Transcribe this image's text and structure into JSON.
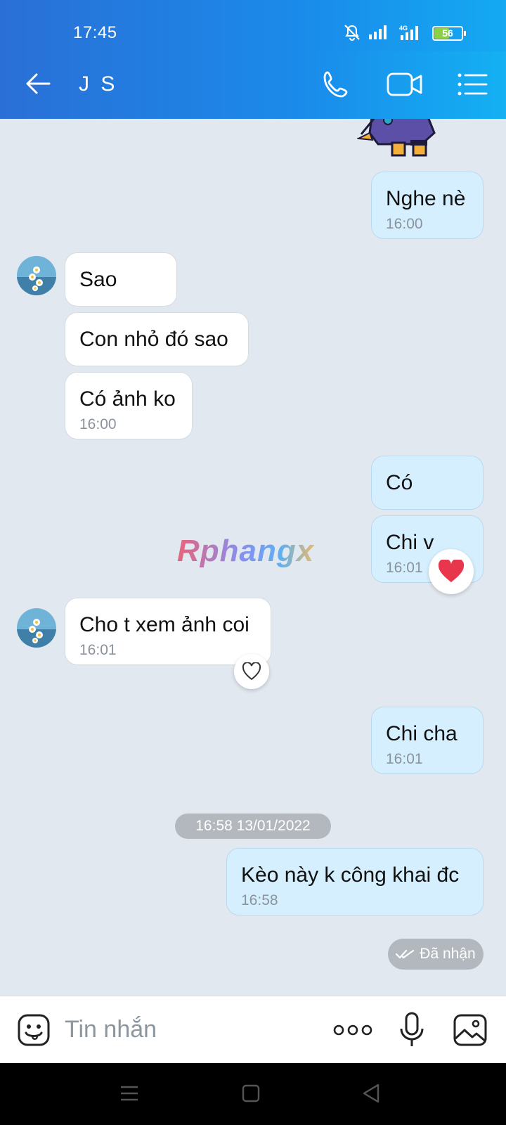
{
  "status_bar": {
    "time": "17:45",
    "battery": "56",
    "battery_level": 0.56,
    "network": "4G"
  },
  "header": {
    "title": "J S"
  },
  "messages": {
    "m1": {
      "text": "Nghe nè",
      "time": "16:00"
    },
    "m2": {
      "text": "Sao"
    },
    "m3": {
      "text": "Con nhỏ đó sao"
    },
    "m4": {
      "text": "Có ảnh ko",
      "time": "16:00"
    },
    "m5": {
      "text": "Có"
    },
    "m6": {
      "text": "Chi v",
      "time": "16:01"
    },
    "m7": {
      "text": "Cho t xem ảnh coi",
      "time": "16:01"
    },
    "m8": {
      "text": "Chi cha",
      "time": "16:01"
    },
    "m9": {
      "text": "Kèo này k công khai đc",
      "time": "16:58"
    }
  },
  "date_separator": "16:58 13/01/2022",
  "delivery_status": "Đã nhận",
  "watermark": "Rphangx",
  "composer": {
    "placeholder": "Tin nhắn"
  },
  "colors": {
    "header_start": "#2a6fd6",
    "header_end": "#14b0f3",
    "outgoing_bubble": "#d6efff",
    "incoming_bubble": "#ffffff",
    "chat_bg": "#e2e8ef",
    "heart": "#e8364c"
  }
}
